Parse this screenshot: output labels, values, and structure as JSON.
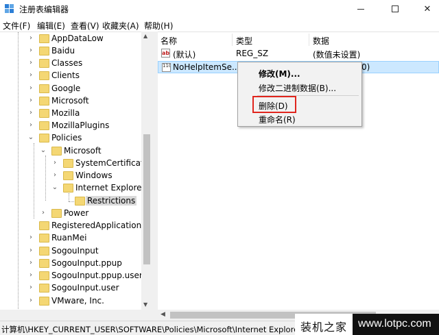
{
  "window": {
    "title": "注册表编辑器",
    "icon": "regedit-icon"
  },
  "menu": [
    "文件(F)",
    "编辑(E)",
    "查看(V)",
    "收藏夹(A)",
    "帮助(H)"
  ],
  "tree": {
    "items": [
      {
        "label": "AppDataLow"
      },
      {
        "label": "Baidu"
      },
      {
        "label": "Classes"
      },
      {
        "label": "Clients"
      },
      {
        "label": "Google"
      },
      {
        "label": "Microsoft"
      },
      {
        "label": "Mozilla"
      },
      {
        "label": "MozillaPlugins"
      },
      {
        "label": "Policies"
      },
      {
        "label": "Microsoft"
      },
      {
        "label": "SystemCertificates"
      },
      {
        "label": "Windows"
      },
      {
        "label": "Internet Explorer"
      },
      {
        "label": "Restrictions"
      },
      {
        "label": "Power"
      },
      {
        "label": "RegisteredApplications"
      },
      {
        "label": "RuanMei"
      },
      {
        "label": "SogouInput"
      },
      {
        "label": "SogouInput.ppup"
      },
      {
        "label": "SogouInput.ppup.user"
      },
      {
        "label": "SogouInput.user"
      },
      {
        "label": "VMware, Inc."
      }
    ]
  },
  "list": {
    "columns": [
      "名称",
      "类型",
      "数据"
    ],
    "rows": [
      {
        "name": "(默认)",
        "type": "REG_SZ",
        "data": "(数值未设置)",
        "icon": "string-value-icon",
        "icon_text": "ab"
      },
      {
        "name": "NoHelpItemSe...",
        "type": "",
        "data": "0)",
        "icon": "binary-value-icon",
        "icon_text": "110"
      }
    ]
  },
  "context_menu": {
    "items": [
      "修改(M)...",
      "修改二进制数据(B)...",
      "删除(D)",
      "重命名(R)"
    ],
    "highlight_color": "#e0241c"
  },
  "status": {
    "path": "计算机\\HKEY_CURRENT_USER\\SOFTWARE\\Policies\\Microsoft\\Internet Explorer\\Re"
  },
  "watermark": {
    "left": "装机之家",
    "right": "www.lotpc.com"
  }
}
